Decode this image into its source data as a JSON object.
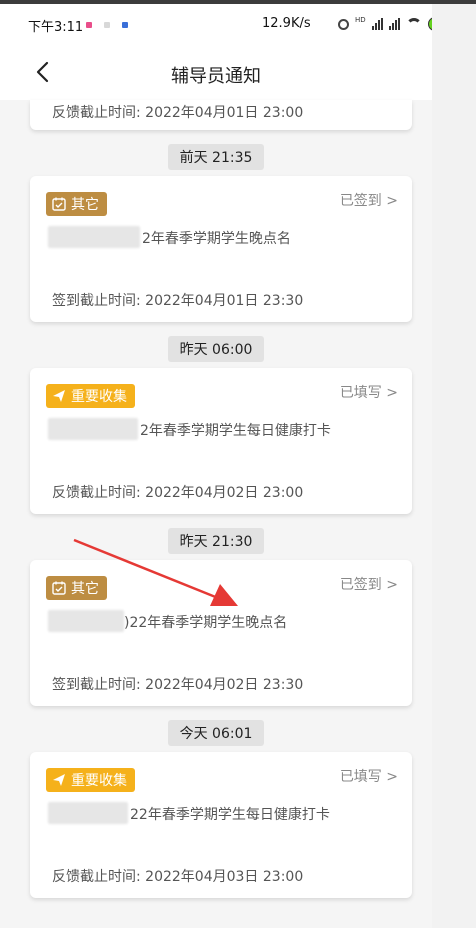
{
  "status_bar": {
    "time": "下午3:11",
    "net_speed": "12.9K/s",
    "hd_label": "HD",
    "battery": "98"
  },
  "header": {
    "title": "辅导员通知"
  },
  "partial_card": {
    "deadline": "反馈截止时间: 2022年04月01日 23:00"
  },
  "groups": [
    {
      "timestamp": "前天 21:35",
      "tag": "其它",
      "tag_color": "#bd8d42",
      "status": "已签到 >",
      "title": "2年春季学期学生晚点名",
      "deadline": "签到截止时间: 2022年04月01日 23:30"
    },
    {
      "timestamp": "昨天 06:00",
      "tag": "重要收集",
      "tag_color": "#f5b11b",
      "status": "已填写 >",
      "title": "2年春季学期学生每日健康打卡",
      "deadline": "反馈截止时间: 2022年04月02日 23:00"
    },
    {
      "timestamp": "昨天 21:30",
      "tag": "其它",
      "tag_color": "#bd8d42",
      "status": "已签到 >",
      "title": ")22年春季学期学生晚点名",
      "deadline": "签到截止时间: 2022年04月02日 23:30"
    },
    {
      "timestamp": "今天 06:01",
      "tag": "重要收集",
      "tag_color": "#f5b11b",
      "status": "已填写 >",
      "title": "22年春季学期学生每日健康打卡",
      "deadline": "反馈截止时间: 2022年04月03日 23:00"
    }
  ],
  "annotation": {
    "color": "#e53935"
  }
}
